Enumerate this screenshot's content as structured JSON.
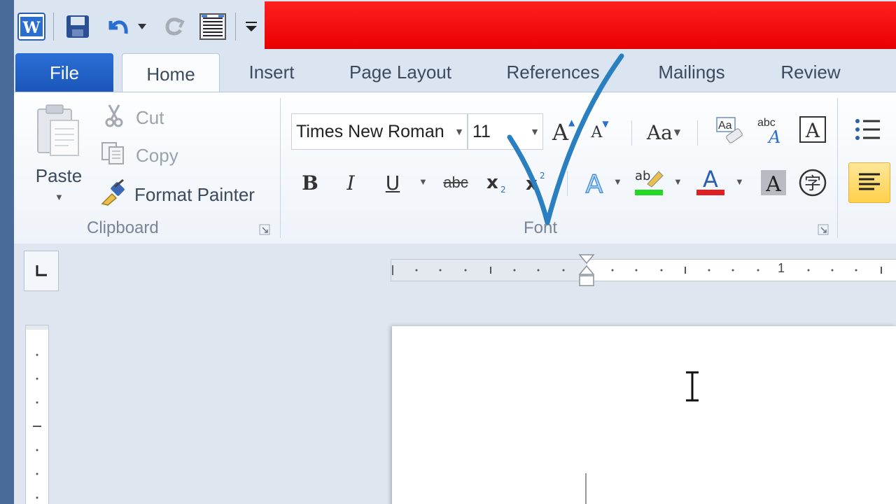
{
  "tabs": [
    {
      "label": "File"
    },
    {
      "label": "Home"
    },
    {
      "label": "Insert"
    },
    {
      "label": "Page Layout"
    },
    {
      "label": "References"
    },
    {
      "label": "Mailings"
    },
    {
      "label": "Review"
    }
  ],
  "clipboard": {
    "paste": "Paste",
    "cut": "Cut",
    "copy": "Copy",
    "format_painter": "Format Painter",
    "group_label": "Clipboard"
  },
  "font": {
    "font_name": "Times New Roman",
    "font_size": "11",
    "group_label": "Font",
    "bold": "B",
    "italic": "I",
    "underline": "U",
    "strikethrough": "abc",
    "change_case": "Aa",
    "clear_format": "A",
    "highlight_text": "ab",
    "font_color_text": "A",
    "grow": "A",
    "shrink": "A"
  },
  "ruler": {
    "tick_label": "1"
  },
  "colors": {
    "title_bar": "#e80000",
    "file_tab": "#1e5fc4",
    "highlight": "#22d822",
    "font_color": "#e02020",
    "annotation": "#2a7fc0"
  }
}
